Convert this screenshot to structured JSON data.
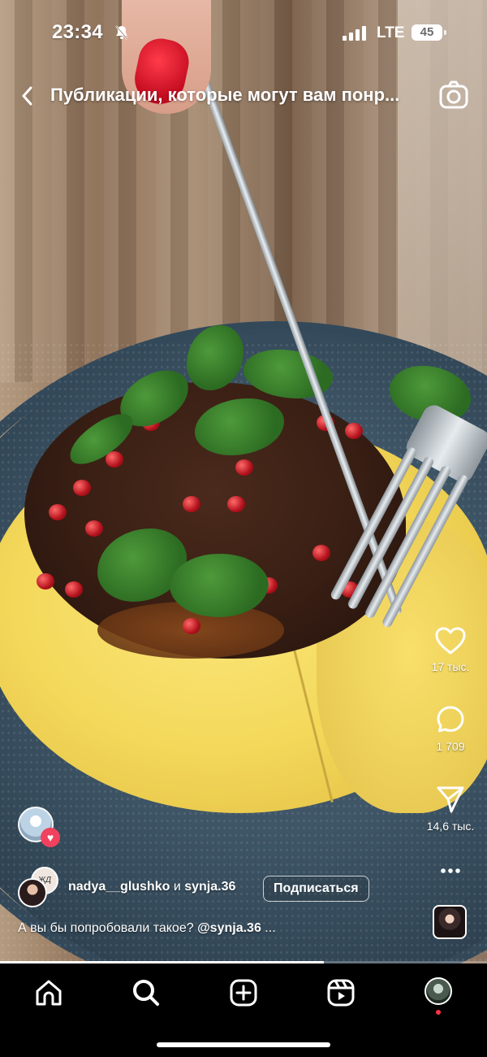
{
  "status_bar": {
    "time": "23:34",
    "network": "LTE",
    "battery": "45",
    "icons": [
      "bell-slash-icon",
      "signal-icon",
      "battery-icon"
    ]
  },
  "header": {
    "title": "Публикации, которые могут вам понр...",
    "icons": [
      "chevron-left-icon",
      "camera-icon"
    ]
  },
  "actions": {
    "likes": "17 тыс.",
    "comments": "1 709",
    "shares": "14,6 тыс.",
    "icons": [
      "heart-icon",
      "comment-icon",
      "send-icon",
      "more-icon"
    ]
  },
  "post": {
    "author_primary": "nadya__glushko",
    "conjunction": "и",
    "author_secondary": "synja.36",
    "follow_label": "Подписаться",
    "caption_text": "А вы бы попробовали такое?",
    "caption_mention": "@synja.36",
    "caption_more": "...",
    "avatar_b_text": "ЖД"
  },
  "playback": {
    "progress_fraction": 0.665
  },
  "tabbar": {
    "icons": [
      "home-icon",
      "search-icon",
      "create-icon",
      "reels-icon",
      "profile-avatar"
    ]
  },
  "colors": {
    "tab_background": "#000000",
    "notification_dot": "#ff3040",
    "like_badge": "#f0415f"
  }
}
